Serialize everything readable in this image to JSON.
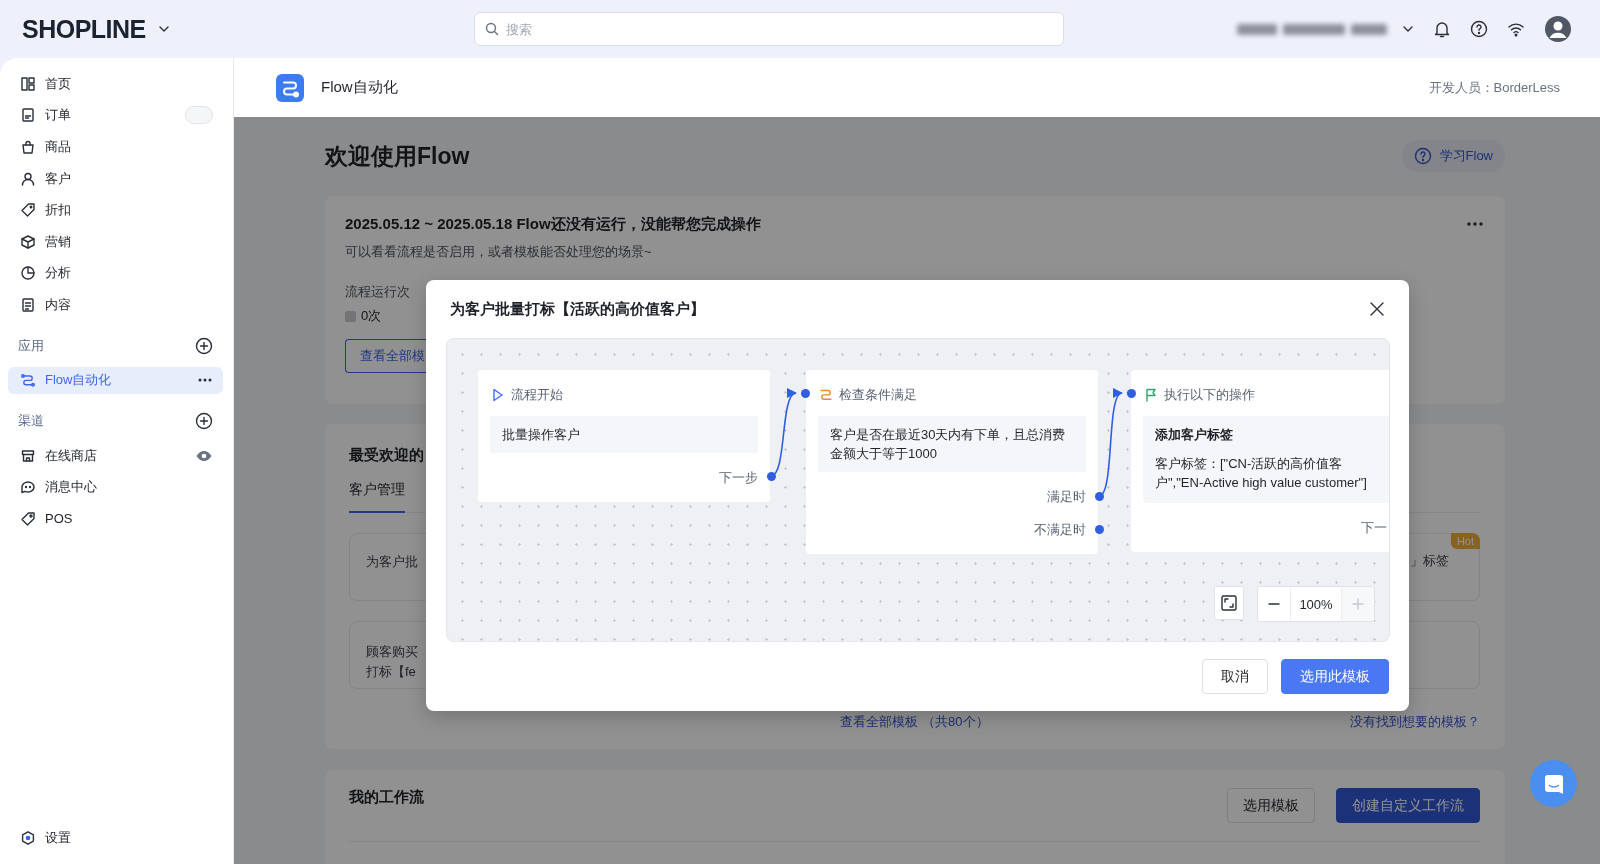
{
  "topbar": {
    "logo": "SHOPLINE",
    "search": {
      "placeholder": "搜索"
    }
  },
  "sidebar": {
    "groups": [
      {
        "items": [
          {
            "label": "首页",
            "selected": false
          },
          {
            "label": "订单",
            "selected": false
          },
          {
            "label": "商品",
            "selected": false
          },
          {
            "label": "客户",
            "selected": false
          },
          {
            "label": "折扣",
            "selected": false
          },
          {
            "label": "营销",
            "selected": false
          },
          {
            "label": "分析",
            "selected": false
          },
          {
            "label": "内容",
            "selected": false
          }
        ]
      },
      {
        "title": "应用",
        "items": [
          {
            "label": "Flow自动化",
            "selected": true
          }
        ]
      },
      {
        "title": "渠道",
        "items": [
          {
            "label": "在线商店",
            "selected": false
          },
          {
            "label": "消息中心",
            "selected": false
          },
          {
            "label": "POS",
            "selected": false
          }
        ]
      }
    ],
    "footer": {
      "label": "设置",
      "selected": false
    }
  },
  "app_header": {
    "title": "Flow自动化",
    "developer": "开发人员：BorderLess"
  },
  "page": {
    "title": "欢迎使用Flow",
    "help_button": "学习Flow",
    "run_card": {
      "title": "2025.05.12 ~ 2025.05.18 Flow还没有运行，没能帮您完成操作",
      "subtitle": "可以看看流程是否启用，或者模板能否处理您的场景~",
      "stat_label": "流程运行次",
      "stat_value": "0次",
      "button": "查看全部模"
    },
    "templates_card": {
      "title": "最受欢迎的",
      "tabs": [
        {
          "label": "客户管理",
          "selected": true
        }
      ],
      "templates": [
        {
          "lines": [
            "为客户批"
          ],
          "right_text": "」标签",
          "badge": "Hot"
        },
        {
          "lines": [
            "顾客购买",
            "打标【fe"
          ]
        }
      ],
      "all_link": "查看全部模板 （共80个）",
      "missing_link": "没有找到想要的模板？"
    },
    "workflows_card": {
      "title": "我的工作流",
      "buttons": [
        {
          "label": "选用模板",
          "kind": "secondary"
        },
        {
          "label": "创建自定义工作流",
          "kind": "primary"
        }
      ]
    }
  },
  "modal": {
    "title": "为客户批量打标【活跃的高价值客户】",
    "nodes": [
      {
        "kind": "start",
        "title": "流程开始",
        "body": {
          "text": "批量操作客户"
        },
        "outputs": [
          "下一步"
        ]
      },
      {
        "kind": "condition",
        "title": "检查条件满足",
        "body": {
          "text": "客户是否在最近30天内有下单，且总消费金额大于等于1000"
        },
        "outputs": [
          "满足时",
          "不满足时"
        ]
      },
      {
        "kind": "action",
        "title": "执行以下的操作",
        "body": {
          "text": "添加客户标签",
          "detail": "客户标签：[\"CN-活跃的高价值客户\",\"EN-Active high value customer\"]"
        },
        "outputs": [
          "下一"
        ]
      }
    ],
    "zoom": {
      "value": "100%",
      "zoom_in_disabled": true
    },
    "buttons": [
      {
        "label": "取消",
        "kind": "secondary"
      },
      {
        "label": "选用此模板",
        "kind": "primary"
      }
    ]
  }
}
